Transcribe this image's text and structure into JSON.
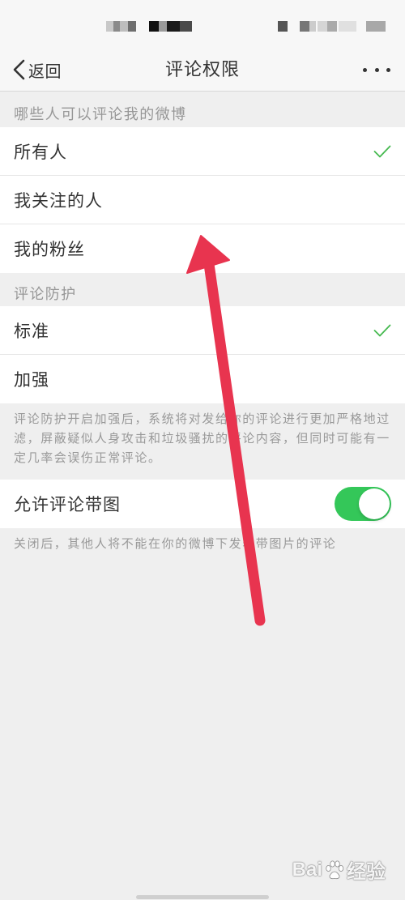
{
  "nav": {
    "back_label": "返回",
    "title": "评论权限"
  },
  "who_can_comment": {
    "header": "哪些人可以评论我的微博",
    "options": [
      {
        "label": "所有人",
        "selected": true
      },
      {
        "label": "我关注的人",
        "selected": false
      },
      {
        "label": "我的粉丝",
        "selected": false
      }
    ]
  },
  "comment_protection": {
    "header": "评论防护",
    "options": [
      {
        "label": "标准",
        "selected": true
      },
      {
        "label": "加强",
        "selected": false
      }
    ],
    "description_lines": [
      "评论防护开启加强后，系统将对发给你的评论进行更加严格地过",
      "滤，屏蔽疑似人身攻击和垃圾骚扰的评论内容，但同时可能有一",
      "定几率会误伤正常评论。"
    ]
  },
  "image_comments": {
    "label": "允许评论带图",
    "enabled": true,
    "note": "关闭后，其他人将不能在你的微博下发表带图片的评论"
  },
  "icons": {
    "back": "chevron-left-icon",
    "more": "more-dots-icon",
    "selected": "checkmark-icon",
    "watermark_logo": "paw-icon"
  },
  "colors": {
    "accent_check": "#45b94f",
    "toggle_on": "#34c759",
    "annotation_arrow": "#e8344f",
    "page_background": "#efefef",
    "bar_background": "#f7f7f7",
    "primary_text": "#333333",
    "secondary_text": "#999999"
  },
  "watermark": {
    "text_left": "Bai",
    "text_right": "经验"
  }
}
